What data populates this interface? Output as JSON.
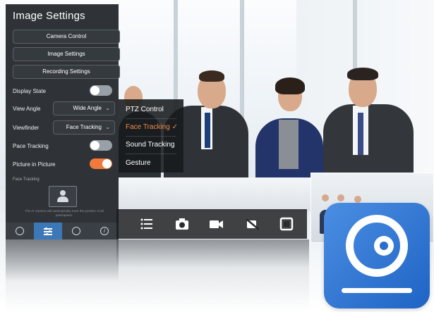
{
  "panel": {
    "title": "Image Settings",
    "buttons": {
      "camera_control": "Camera Control",
      "image_settings": "Image Settings",
      "recording_settings": "Recording Settings"
    },
    "display_state_label": "Display State",
    "display_state_on": false,
    "view_angle_label": "View Angle",
    "view_angle_value": "Wide Angle",
    "viewfinder_label": "Viewfinder",
    "viewfinder_value": "Face Tracking",
    "pace_tracking_label": "Pace Tracking",
    "pace_tracking_on": false,
    "pip_label": "Picture in Picture",
    "pip_on": true,
    "face_tracking_subhead": "Face Tracking",
    "help_text": "The AI Camera will automatically track the position of all participants.",
    "accent_color": "#f07a3b"
  },
  "tabs": {
    "items": [
      {
        "icon": "camera-lens-icon",
        "active": false
      },
      {
        "icon": "sliders-icon",
        "active": true
      },
      {
        "icon": "target-icon",
        "active": false
      },
      {
        "icon": "info-icon",
        "active": false
      }
    ],
    "active_color": "#3c77b8"
  },
  "ptz_menu": {
    "items": [
      {
        "label": "PTZ Control",
        "selected": false
      },
      {
        "label": "Face Tracking",
        "selected": true
      },
      {
        "label": "Sound Tracking",
        "selected": false
      },
      {
        "label": "Gesture",
        "selected": false
      }
    ],
    "selected_color": "#f08a4b"
  },
  "action_bar": {
    "icons": [
      "menu-icon",
      "camera-icon",
      "video-icon",
      "no-video-icon",
      "fullscreen-icon"
    ]
  },
  "app_icon": {
    "icon": "camera-app-icon",
    "color": "#2a6fd0"
  }
}
